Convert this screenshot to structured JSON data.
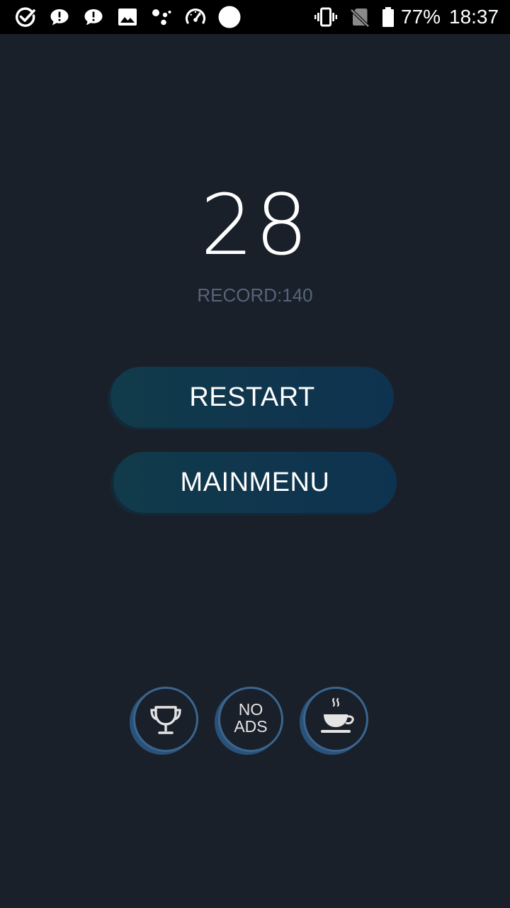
{
  "status_bar": {
    "icons": [
      "check-circle-icon",
      "message-icon",
      "message-icon",
      "image-icon",
      "assistant-icon",
      "speedometer-icon",
      "circle-icon",
      "vibrate-icon",
      "no-sim-icon",
      "battery-icon"
    ],
    "battery": "77%",
    "time": "18:37"
  },
  "game": {
    "score": "28",
    "record": "RECORD:140"
  },
  "buttons": {
    "restart": "RESTART",
    "mainmenu": "MAINMENU"
  },
  "bottom_actions": {
    "leaderboard_icon": "trophy-icon",
    "no_ads_line1": "NO",
    "no_ads_line2": "ADS",
    "donate_icon": "coffee-cup-icon"
  },
  "colors": {
    "background": "#1a202a",
    "button_bg": "#0e3350",
    "ring": "#3a6690",
    "record_text": "#56647a"
  }
}
